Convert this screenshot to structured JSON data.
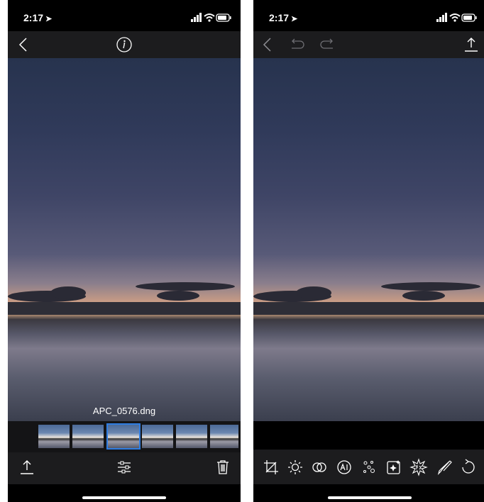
{
  "left": {
    "status": {
      "time": "2:17",
      "location_glyph": "➤"
    },
    "topbar": {
      "back_icon": "chevron-left-icon",
      "info_icon": "info-icon"
    },
    "filename": "APC_0576.dng",
    "filmstrip": {
      "count": 6,
      "selected_index": 2
    },
    "bottombar": {
      "share_icon": "share-icon",
      "adjust_icon": "sliders-icon",
      "delete_icon": "trash-icon"
    }
  },
  "right": {
    "status": {
      "time": "2:17",
      "location_glyph": "➤"
    },
    "topbar": {
      "back_icon": "chevron-left-icon",
      "undo_icon": "undo-icon",
      "redo_icon": "redo-icon",
      "share_icon": "share-icon"
    },
    "tools": [
      "crop-icon",
      "light-icon",
      "color-icon",
      "ai-icon",
      "detail-icon",
      "enhance-icon",
      "effects-icon",
      "brush-icon",
      "reset-icon"
    ]
  },
  "colors": {
    "accent": "#2f7de1",
    "bar": "#1c1c1e",
    "icon": "#ffffff",
    "icon_dim": "#6e6e73"
  }
}
